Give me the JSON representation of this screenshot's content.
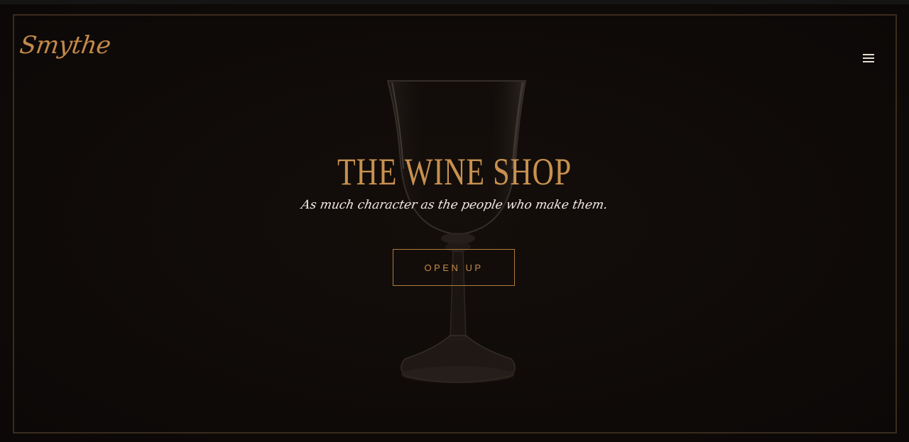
{
  "brand": {
    "logo_text": "Smythe"
  },
  "header": {
    "menu_icon": "hamburger-menu-icon"
  },
  "hero": {
    "title": "THE WINE SHOP",
    "tagline": "As much character as the people who make them.",
    "cta_label": "OPEN UP",
    "background_image": "wine-glass"
  },
  "colors": {
    "background": "#0e0a08",
    "accent_gold": "#c4894a",
    "frame_border": "#3a2c1c",
    "tagline_text": "#f2ece4"
  }
}
